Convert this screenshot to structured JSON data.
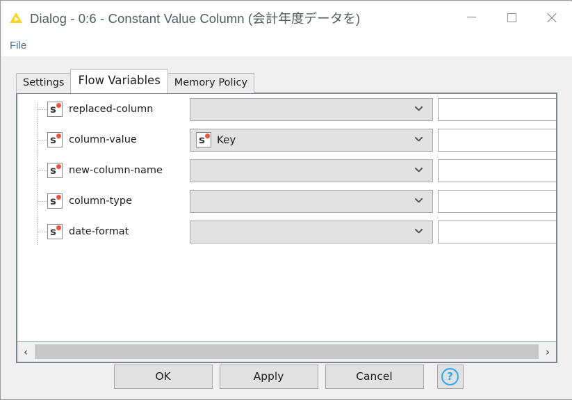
{
  "window": {
    "title": "Dialog - 0:6 - Constant Value Column (会計年度データを)",
    "icon": "knime-triangle-icon",
    "controls": {
      "minimize": "minimize-icon",
      "maximize": "maximize-icon",
      "close": "close-icon"
    }
  },
  "menubar": {
    "items": [
      {
        "label": "File"
      }
    ]
  },
  "tabs": [
    {
      "label": "Settings",
      "active": false
    },
    {
      "label": "Flow Variables",
      "active": true
    },
    {
      "label": "Memory Policy",
      "active": false
    }
  ],
  "flow_variables": {
    "rows": [
      {
        "label": "replaced-column",
        "icon": "flow-variable-string-icon",
        "dropdown_value": "",
        "dropdown_icon": "",
        "textfield_value": ""
      },
      {
        "label": "column-value",
        "icon": "flow-variable-string-icon",
        "dropdown_value": "Key",
        "dropdown_icon": "flow-variable-string-icon",
        "textfield_value": ""
      },
      {
        "label": "new-column-name",
        "icon": "flow-variable-string-icon",
        "dropdown_value": "",
        "dropdown_icon": "",
        "textfield_value": ""
      },
      {
        "label": "column-type",
        "icon": "flow-variable-string-icon",
        "dropdown_value": "",
        "dropdown_icon": "",
        "textfield_value": ""
      },
      {
        "label": "date-format",
        "icon": "flow-variable-string-icon",
        "dropdown_value": "",
        "dropdown_icon": "",
        "textfield_value": ""
      }
    ]
  },
  "scrollbar": {
    "left_arrow": "‹",
    "right_arrow": "›"
  },
  "buttons": {
    "ok": "OK",
    "apply": "Apply",
    "cancel": "Cancel",
    "help": "?"
  },
  "colors": {
    "accent": "#29aaf0",
    "title_icon": "#ffd21e",
    "variable_dot": "#f4503c",
    "dialog_bg": "#f0f0f0",
    "panel_bg": "#ffffff",
    "control_bg": "#e1e1e1",
    "menu_text": "#4a6d8c"
  }
}
